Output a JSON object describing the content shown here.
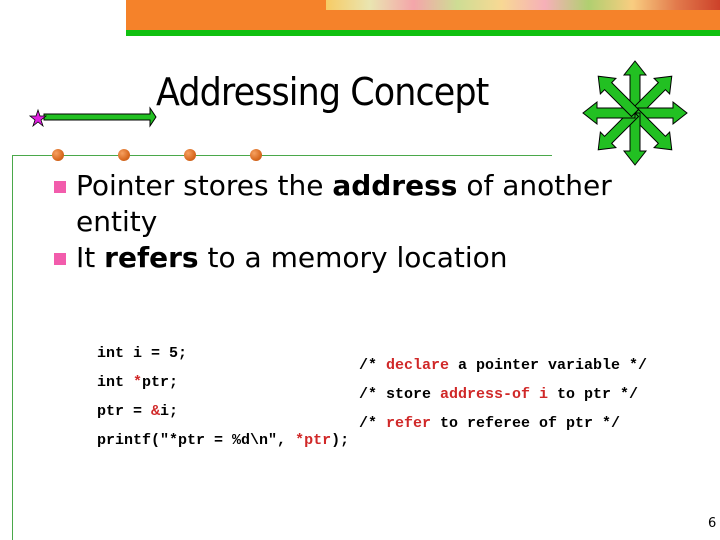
{
  "slide": {
    "title": "Addressing Concept",
    "page_number": "6",
    "colors": {
      "banner_orange": "#f5822a",
      "banner_green": "#10c010",
      "bullet_pink": "#f25cac",
      "code_highlight_red": "#d02828",
      "frame_green": "#4aa84a"
    },
    "icons": [
      "star-arrow-icon",
      "eight-way-arrow-icon"
    ],
    "bullets": [
      {
        "pre": "Pointer stores the ",
        "bold": "address",
        "post": " of another",
        "line2": "entity"
      },
      {
        "pre": "It ",
        "bold": "refers",
        "post": " to a memory location",
        "line2": ""
      }
    ],
    "code": {
      "line1": {
        "code": "int i = 5;"
      },
      "line2": {
        "code_a": "int ",
        "code_red": "*",
        "code_b": "ptr;",
        "c_open": "/* ",
        "c_red": "declare",
        "c_rest": " a pointer variable */"
      },
      "line3": {
        "code_a": "ptr = ",
        "code_red": "&",
        "code_b": "i;",
        "c_open": "/* store ",
        "c_red": "address-of i",
        "c_rest": " to ptr */"
      },
      "line4": {
        "code_a": "printf(\"*ptr = %d\\n\", ",
        "code_red": "*ptr",
        "code_b": ");",
        "c_open": "/* ",
        "c_red": "refer",
        "c_rest": " to referee of ptr */"
      }
    }
  }
}
